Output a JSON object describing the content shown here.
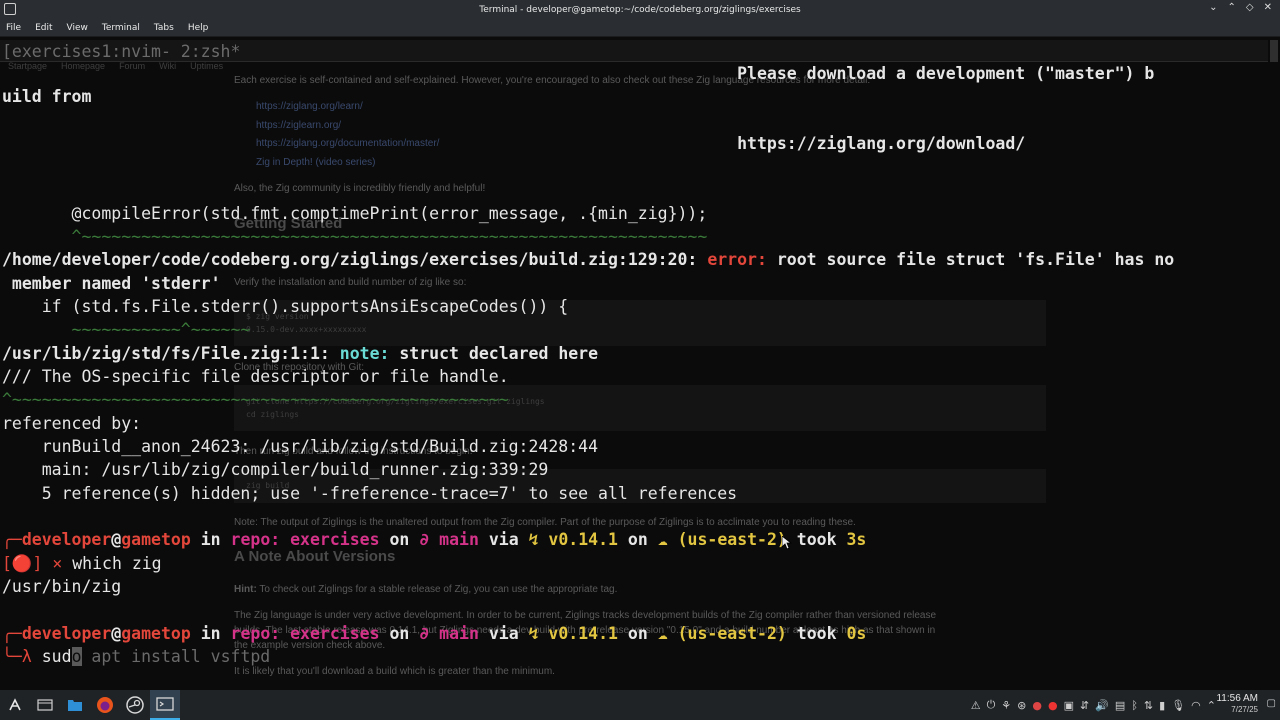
{
  "window": {
    "title": "Terminal - developer@gametop:~/code/codeberg.org/ziglings/exercises",
    "controls": [
      "⌄",
      "⌃",
      "◇",
      "✕"
    ]
  },
  "menu": [
    "File",
    "Edit",
    "View",
    "Terminal",
    "Tabs",
    "Help"
  ],
  "tmux": {
    "status": "[exercises1:nvim- 2:zsh*"
  },
  "background_doc": {
    "nav": [
      "Startpage",
      "Homepage",
      "Forum",
      "Wiki",
      "Uptimes"
    ],
    "intro": "Each exercise is self-contained and self-explained. However, you're encouraged to also check out these Zig language resources for more detail:",
    "links": [
      "https://ziglang.org/learn/",
      "https://ziglearn.org/",
      "https://ziglang.org/documentation/master/",
      "Zig in Depth! (video series)"
    ],
    "community": "Also, the Zig community is incredibly friendly and helpful!",
    "h_getting_started": "Getting Started",
    "verify": "Verify the installation and build number of zig like so:",
    "code1_a": "$ zig version",
    "code1_b": "0.15.0-dev.xxxx+xxxxxxxxx",
    "clone": "Clone this repository with Git:",
    "code2_a": "git clone https://codeberg.org/ziglings/exercises.git ziglings",
    "code2_b": "cd ziglings",
    "then_run": "Then run zig build and follow the instructions to begin!",
    "code3": "zig build",
    "note": "Note: The output of Ziglings is the unaltered output from the Zig compiler. Part of the purpose of Ziglings is to acclimate you to reading these.",
    "h_versions": "A Note About Versions",
    "hint_label": "Hint:",
    "hint": " To check out Ziglings for a stable release of Zig, you can use the appropriate tag.",
    "para1": "The Zig language is under very active development. In order to be current, Ziglings tracks development builds of the Zig compiler rather than versioned release",
    "para2": "builds. The last stable release was 0.14.1, but Ziglings needs a dev build with pre-release version \"0.15.0\" and a build number at least as high as that shown in",
    "para3": "the example version check above.",
    "para4": "It is likely that you'll download a build which is greater than the minimum."
  },
  "terminal": {
    "l1": "                                                                          Please download a development (\"master\") b",
    "l2": "uild from",
    "l3": "                                                                          https://ziglang.org/download/",
    "l4": "       @compileError(std.fmt.comptimePrint(error_message, .{min_zig}));",
    "l5": "       ^~~~~~~~~~~~~~~~~~~~~~~~~~~~~~~~~~~~~~~~~~~~~~~~~~~~~~~~~~~~~~~~",
    "l6_path": "/home/developer/code/codeberg.org/ziglings/exercises/build.zig:129:20: ",
    "l6_err": "error: ",
    "l6_msg": "root source file struct 'fs.File' has no",
    "l7": " member named 'stderr'",
    "l8": "    if (std.fs.File.stderr().supportsAnsiEscapeCodes()) {",
    "l9": "       ~~~~~~~~~~~^~~~~~~",
    "l10_path": "/usr/lib/zig/std/fs/File.zig:1:1: ",
    "l10_note": "note: ",
    "l10_msg": "struct declared here",
    "l11": "/// The OS-specific file descriptor or file handle.",
    "l12": "^~~~~~~~~~~~~~~~~~~~~~~~~~~~~~~~~~~~~~~~~~~~~~~~~~~",
    "l13": "referenced by:",
    "l14": "    runBuild__anon_24623: /usr/lib/zig/std/Build.zig:2428:44",
    "l15": "    main: /usr/lib/zig/compiler/build_runner.zig:339:29",
    "l16": "    5 reference(s) hidden; use '-freference-trace=7' to see all references",
    "prompt1": {
      "user": "developer",
      "at": "@",
      "host": "gametop",
      "in": " in ",
      "repo": "repo: exercises",
      "on": " on ",
      "branch": "∂ main",
      "via": " via ",
      "ver": "↯ v0.14.1",
      "on2": " on ",
      "region": "☁ (us-east-2)",
      "took": " took ",
      "time": "3s"
    },
    "status_mark": "[🔴] ×",
    "cmd1": " which zig",
    "out1": "/usr/bin/zig",
    "prompt2_time": "0s",
    "lambda": "λ",
    "typed": " sud",
    "cursor_char": "o",
    "suggest": " apt install vsftpd"
  },
  "taskbar": {
    "clock_time": "11:56 AM",
    "clock_date": "7/27/25"
  }
}
